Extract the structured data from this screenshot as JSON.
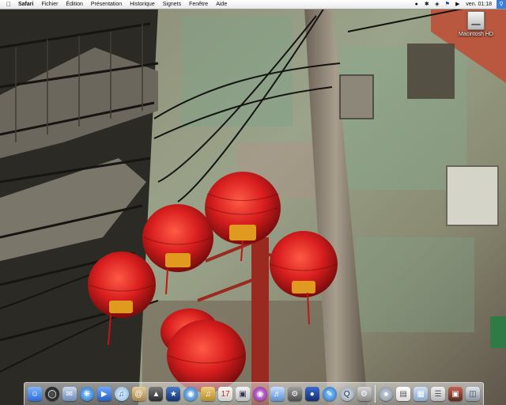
{
  "menubar": {
    "apple_icon": "apple-icon",
    "app_name": "Safari",
    "menus": [
      "Fichier",
      "Édition",
      "Présentation",
      "Historique",
      "Signets",
      "Fenêtre",
      "Aide"
    ],
    "status_icons": [
      "user-icon",
      "bluetooth-icon",
      "wifi-icon",
      "flag-icon",
      "volume-icon"
    ],
    "clock": "ven. 01:18",
    "spotlight_icon": "spotlight-icon"
  },
  "desktop": {
    "hd_icon": {
      "icon": "hard-drive-icon",
      "label": "Macintosh HD"
    }
  },
  "dock": {
    "apps": [
      "finder-icon",
      "dashboard-icon",
      "mail-icon",
      "safari-icon",
      "ichat-icon",
      "itunes-icon",
      "address-book-icon",
      "iphoto-icon",
      "imovie-icon",
      "idvd-icon",
      "garageband-icon",
      "ical-icon",
      "preview-icon",
      "calendar-icon",
      "itunes-store-icon",
      "automator-icon",
      "photo-booth-icon",
      "textedit-icon",
      "quicktime-icon",
      "system-preferences-icon"
    ],
    "stacks": [
      "network-icon",
      "document-icon",
      "folder-icon",
      "stack-icon",
      "photo-icon",
      "trash-icon"
    ]
  },
  "colors": {
    "menubar_bg": "#f4f4f4",
    "spotlight_bg": "#3a7de0",
    "lantern_red": "#d81e1e"
  }
}
